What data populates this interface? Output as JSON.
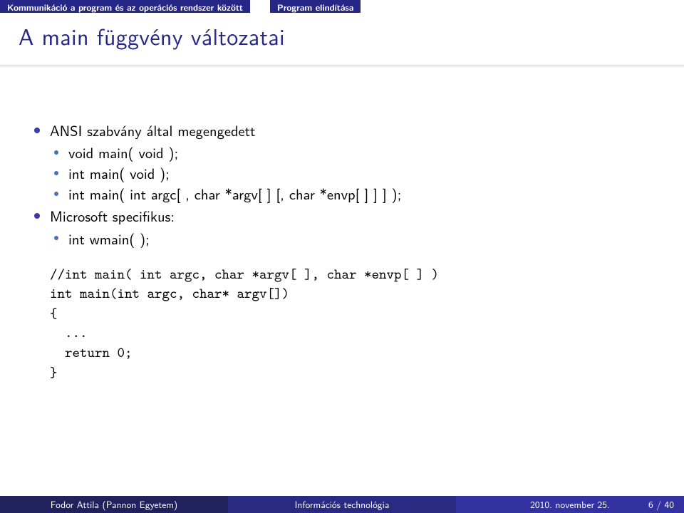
{
  "nav": {
    "section": "Kommunikáció a program és az operációs rendszer között",
    "sub": "Program elindítása"
  },
  "title": "A main függvény változatai",
  "bullets": {
    "ansi": "ANSI szabvány által megengedett",
    "ansi_items": {
      "a": "void main( void );",
      "b": "int main( void );",
      "c": "int main( int argc[ , char *argv[ ] [, char *envp[ ] ] ] );"
    },
    "ms": "Microsoft specifikus:",
    "ms_items": {
      "a": "int wmain( );"
    }
  },
  "code": "//int main( int argc, char *argv[ ], char *envp[ ] )\nint main(int argc, char* argv[])\n{\n  ...\n  return 0;\n}",
  "footer": {
    "author": "Fodor Attila (Pannon Egyetem)",
    "title": "Információs technológia",
    "date": "2010. november 25.",
    "page": "6 / 40"
  }
}
